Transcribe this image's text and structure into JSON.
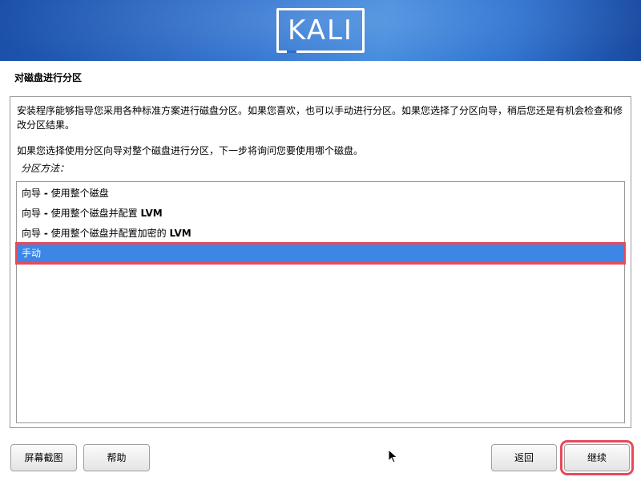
{
  "header": {
    "logo_text": "KALI"
  },
  "page": {
    "title": "对磁盘进行分区"
  },
  "content": {
    "description": "安装程序能够指导您采用各种标准方案进行磁盘分区。如果您喜欢，也可以手动进行分区。如果您选择了分区向导，稍后您还是有机会检查和修改分区结果。",
    "description2": "如果您选择使用分区向导对整个磁盘进行分区，下一步将询问您要使用哪个磁盘。",
    "method_label": "分区方法："
  },
  "options": [
    {
      "prefix": "向导 ",
      "dash": "-",
      "text": " 使用整个磁盘",
      "bold_suffix": ""
    },
    {
      "prefix": "向导 ",
      "dash": "-",
      "text": " 使用整个磁盘并配置 ",
      "bold_suffix": "LVM"
    },
    {
      "prefix": "向导 ",
      "dash": "-",
      "text": " 使用整个磁盘并配置加密的 ",
      "bold_suffix": "LVM"
    },
    {
      "prefix": "",
      "dash": "",
      "text": "手动",
      "bold_suffix": "",
      "selected": true
    }
  ],
  "buttons": {
    "screenshot": "屏幕截图",
    "help": "帮助",
    "back": "返回",
    "continue": "继续"
  },
  "colors": {
    "banner": "#2a6fcf",
    "selection": "#3d86e6",
    "highlight": "#e84a5a"
  },
  "icons": {
    "cursor": "mouse-pointer-icon"
  }
}
